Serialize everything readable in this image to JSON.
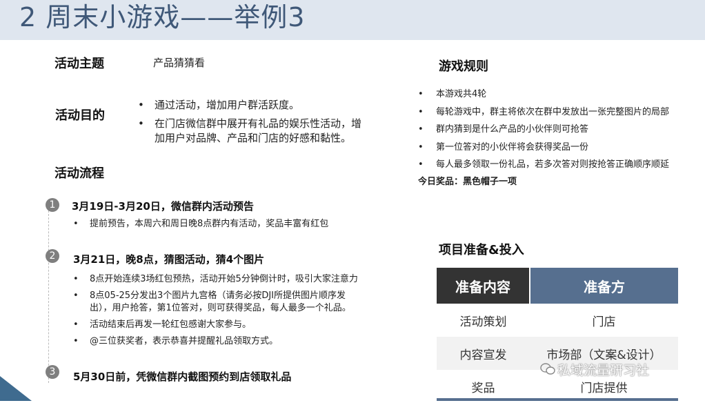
{
  "title": "2 周末小游戏——举例3",
  "theme": {
    "label": "活动主题",
    "value": "产品猜猜看"
  },
  "goal": {
    "label": "活动目的",
    "items": [
      "通过活动，增加用户群活跃度。",
      "在门店微信群中展开有礼品的娱乐性活动，增",
      "加用户对品牌、产品和门店的好感和黏性。"
    ]
  },
  "process": {
    "label": "活动流程",
    "steps": [
      {
        "num": "1",
        "title": "3月19日-3月20日，微信群内活动预告",
        "items": [
          "提前预告，本周六和周日晚8点群内有活动，奖品丰富有红包"
        ]
      },
      {
        "num": "2",
        "title": "3月21日，晚8点，猜图活动，猜4个图片",
        "items": [
          "8点开始连续3场红包预热，活动开始5分钟倒计时，吸引大家注意力",
          "8点05-25分发出3个图片九宫格（请务必按DJI所提供图片顺序发",
          "出），用户抢答，第1位答对，则可获得奖品，每人最多一个礼品。",
          "活动结束后再发一轮红包感谢大家参与。",
          "@三位获奖者，表示恭喜并提醒礼品领取方式。"
        ]
      },
      {
        "num": "3",
        "title": "5月30日前，凭微信群内截图预约到店领取礼品",
        "items": []
      }
    ]
  },
  "rules": {
    "label": "游戏规则",
    "items": [
      "本游戏共4轮",
      "每轮游戏中，群主将依次在群中发放出一张完整图片的局部",
      "群内猜到是什么产品的小伙伴则可抢答",
      "第一位答对的小伙伴将会获得奖品一份",
      "每人最多领取一份礼品，若多次答对则按抢答正确顺序顺延"
    ],
    "prize": "今日奖品：黑色帽子一项"
  },
  "prep": {
    "label": "项目准备&投入",
    "headers": [
      "准备内容",
      "准备方"
    ],
    "rows": [
      [
        "活动策划",
        "门店"
      ],
      [
        "内容宣发",
        "市场部（文案&设计）"
      ],
      [
        "奖品",
        "门店提供"
      ]
    ]
  },
  "watermark": "私域流量研习社",
  "colors": {
    "header_bg": "#dfe6ef",
    "title": "#3f5878",
    "table_dark": "#333333",
    "table_blue": "#566f8f"
  }
}
